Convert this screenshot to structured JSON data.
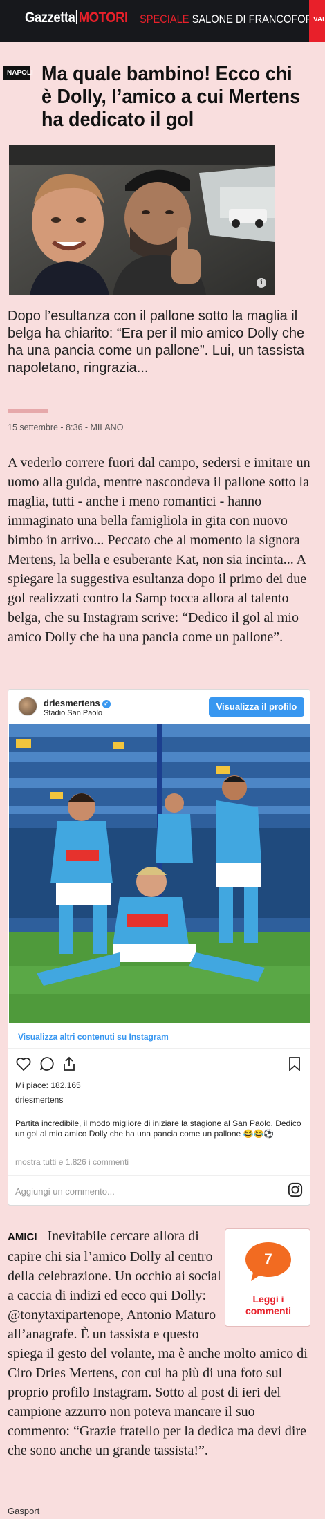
{
  "topbar": {
    "logo_brand": "Gazzetta",
    "logo_section": "MOTORI",
    "speciale_label": "SPECIALE",
    "speciale_event": "SALONE DI FRANCOFORTE",
    "cta": "VAI A"
  },
  "article": {
    "section": "NAPOLI",
    "title": "Ma quale bambino! Ecco chi è Dolly, l’amico a cui Mertens ha dedicato il gol",
    "summary": "Dopo l’esultanza con il pallone sotto la maglia il belga ha chiarito: “Era per il mio amico Dolly che ha una pancia come un pallone”. Lui, un tassista napoletano, ringrazia...",
    "meta": "15 settembre - 8:36 - MILANO",
    "paragraph1": "A vederlo correre fuori dal campo, sedersi e imitare un uomo alla guida, mentre nascondeva il pallone sotto la maglia, tutti - anche i meno romantici - hanno immaginato una bella famigliola in gita con nuovo bimbo in arrivo... Peccato che al momento la signora Mertens, la bella e esuberante Kat, non sia incinta... A spiegare la suggestiva esultanza dopo il primo dei due gol realizzati contro la Samp tocca allora al talento belga, che su Instagram scrive: “Dedico il gol al mio amico Dolly che ha una pancia come un pallone”.",
    "amici_label": "AMICI",
    "paragraph2": "– Inevitabile cercare allora di capire chi sia l’amico Dolly al centro della celebrazione. Un occhio ai social a caccia di indizi ed ecco qui Dolly: @tonytaxipartenope, Antonio Maturo all’anagrafe. È un tassista e questo spiega il gesto del volante, ma è anche molto amico di Ciro Dries Mertens, con cui ha più di una foto sul proprio profilo Instagram. Sotto al post di ieri del campione azzurro non poteva mancare il suo commento: “Grazie fratello per la dedica ma devi dire che sono anche un grande tassista!”.",
    "author": "Gasport"
  },
  "instagram": {
    "username": "driesmertens",
    "location": "Stadio San Paolo",
    "profile_button": "Visualizza il profilo",
    "more_link": "Visualizza altri contenuti su Instagram",
    "likes": "Mi piace: 182.165",
    "owner": "driesmertens",
    "caption": "Partita incredibile, il modo migliore di iniziare la stagione al San Paolo. Dedico un gol al mio amico Dolly che ha una pancia come un pallone 😂😂⚽",
    "comments": "mostra tutti e 1.826 i commenti",
    "comment_placeholder": "Aggiungi un commento..."
  },
  "comments_widget": {
    "count": "7",
    "label_line1": "Leggi i",
    "label_line2": "commenti"
  },
  "colors": {
    "page_bg": "#f9dede",
    "topbar_bg": "#17181c",
    "accent_red": "#e8202a",
    "bubble_orange": "#f26b21",
    "instagram_blue": "#3897f0"
  }
}
